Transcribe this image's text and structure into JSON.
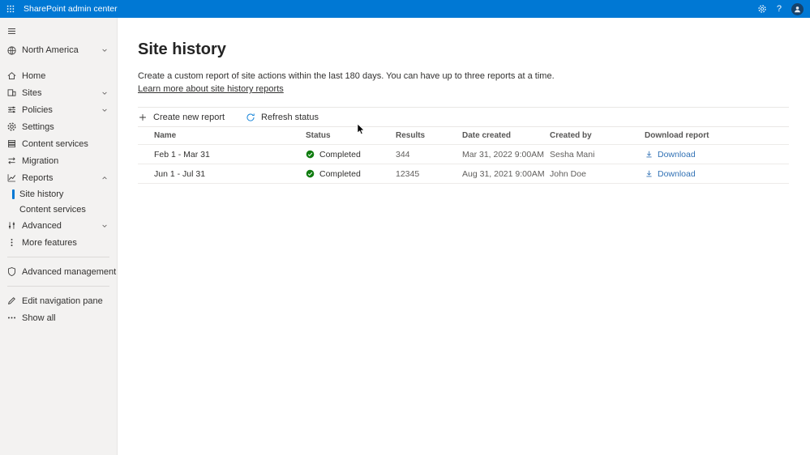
{
  "colors": {
    "accent": "#0078d4",
    "topbar_bg": "#0078d4",
    "sidebar_bg": "#f3f2f1",
    "success": "#107c10",
    "link": "#3272b5",
    "text": "#323130",
    "muted": "#605e5c"
  },
  "topbar": {
    "title": "SharePoint admin center",
    "help": "?"
  },
  "sidebar": {
    "org": "North America",
    "items": [
      {
        "label": "Home",
        "icon": "#i-home"
      },
      {
        "label": "Sites",
        "icon": "#i-sites",
        "chevron": "#i-chev-down"
      },
      {
        "label": "Policies",
        "icon": "#i-policies",
        "chevron": "#i-chev-down"
      },
      {
        "label": "Settings",
        "icon": "#i-gear"
      },
      {
        "label": "Content services",
        "icon": "#i-content"
      },
      {
        "label": "Migration",
        "icon": "#i-migration"
      },
      {
        "label": "Reports",
        "icon": "#i-reports",
        "chevron": "#i-chev-up"
      },
      {
        "label": "Site history",
        "selected": true
      },
      {
        "label": "Content services"
      },
      {
        "label": "Advanced",
        "icon": "#i-advanced",
        "chevron": "#i-chev-down"
      },
      {
        "label": "More features",
        "icon": "#i-dots-v"
      },
      {
        "label": "Advanced management",
        "icon": "#i-shield"
      },
      {
        "label": "Edit navigation pane",
        "icon": "#i-pencil"
      },
      {
        "label": "Show all",
        "icon": "#i-dots-h"
      }
    ]
  },
  "page": {
    "title": "Site history",
    "description": "Create a custom report of site actions within the last 180 days. You can have up to three reports at a time.",
    "learn_more": "Learn more about site history reports"
  },
  "toolbar": {
    "create": "Create new report",
    "refresh": "Refresh status"
  },
  "table": {
    "columns": [
      "Name",
      "Status",
      "Results",
      "Date created",
      "Created by",
      "Download report"
    ],
    "rows": [
      {
        "name": "Feb 1 - Mar 31",
        "status": "Completed",
        "results": "344",
        "date_created": "Mar 31, 2022 9:00AM",
        "created_by": "Sesha Mani",
        "download": "Download"
      },
      {
        "name": "Jun 1 - Jul 31",
        "status": "Completed",
        "results": "12345",
        "date_created": "Aug 31, 2021 9:00AM",
        "created_by": "John Doe",
        "download": "Download"
      }
    ]
  }
}
